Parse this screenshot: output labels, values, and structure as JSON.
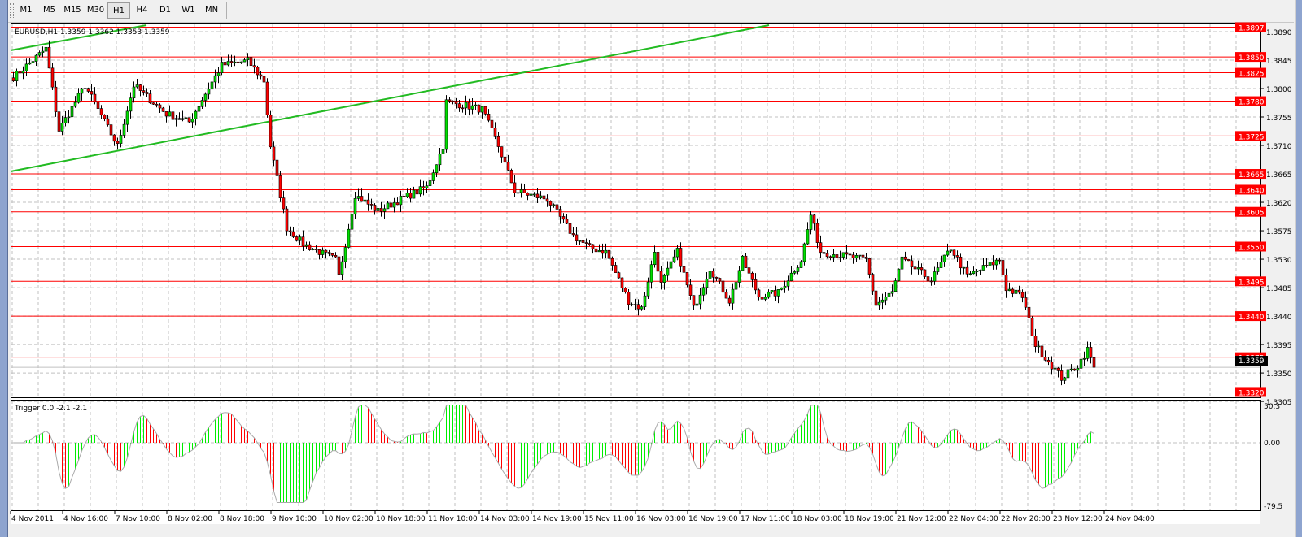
{
  "toolbar": {
    "timeframes": [
      "M1",
      "M5",
      "M15",
      "M30",
      "H1",
      "H4",
      "D1",
      "W1",
      "MN"
    ],
    "active": "H1"
  },
  "chart": {
    "title": "EURUSD,H1  1.3359 1.3362 1.3353 1.3359",
    "current_price": "1.3359",
    "price_ticks": [
      "1.3890",
      "1.3845",
      "1.3800",
      "1.3755",
      "1.3710",
      "1.3665",
      "1.3620",
      "1.3575",
      "1.3530",
      "1.3485",
      "1.3440",
      "1.3395",
      "1.3350",
      "1.3305"
    ],
    "levels": [
      "1.3897",
      "1.3850",
      "1.3825",
      "1.3780",
      "1.3725",
      "1.3665",
      "1.3640",
      "1.3605",
      "1.3550",
      "1.3495",
      "1.3440",
      "1.3375",
      "1.3320"
    ],
    "time_labels": [
      "4 Nov 2011",
      "4 Nov 16:00",
      "7 Nov 10:00",
      "8 Nov 02:00",
      "8 Nov 18:00",
      "9 Nov 10:00",
      "10 Nov 02:00",
      "10 Nov 18:00",
      "11 Nov 10:00",
      "14 Nov 03:00",
      "14 Nov 19:00",
      "15 Nov 11:00",
      "16 Nov 03:00",
      "16 Nov 19:00",
      "17 Nov 11:00",
      "18 Nov 03:00",
      "18 Nov 19:00",
      "21 Nov 12:00",
      "22 Nov 04:00",
      "22 Nov 20:00",
      "23 Nov 12:00",
      "24 Nov 04:00"
    ],
    "colors": {
      "level": "#ff0000",
      "bull": "#00e000",
      "bear": "#ff0000",
      "trend": "#22bb22"
    }
  },
  "indicator": {
    "title": "Trigger 0.0 -2.1 -2.1",
    "max_label": "50.3",
    "zero_label": "0.00",
    "min_label": "-79.5"
  },
  "chart_data": {
    "type": "candlestick",
    "symbol": "EURUSD",
    "timeframe": "H1",
    "ylim": [
      1.33,
      1.39
    ],
    "price_path": [
      [
        0,
        1.3818
      ],
      [
        10,
        1.3863
      ],
      [
        14,
        1.3734
      ],
      [
        22,
        1.3805
      ],
      [
        32,
        1.3709
      ],
      [
        37,
        1.3805
      ],
      [
        47,
        1.376
      ],
      [
        54,
        1.3747
      ],
      [
        64,
        1.3837
      ],
      [
        72,
        1.3844
      ],
      [
        77,
        1.3812
      ],
      [
        79,
        1.3709
      ],
      [
        84,
        1.358
      ],
      [
        89,
        1.3554
      ],
      [
        99,
        1.3529
      ],
      [
        100,
        1.3503
      ],
      [
        105,
        1.3632
      ],
      [
        112,
        1.3606
      ],
      [
        119,
        1.3625
      ],
      [
        127,
        1.3644
      ],
      [
        132,
        1.3709
      ],
      [
        133,
        1.3779
      ],
      [
        139,
        1.3773
      ],
      [
        144,
        1.3767
      ],
      [
        149,
        1.3709
      ],
      [
        154,
        1.3638
      ],
      [
        164,
        1.3625
      ],
      [
        172,
        1.3567
      ],
      [
        177,
        1.3548
      ],
      [
        182,
        1.3542
      ],
      [
        189,
        1.3464
      ],
      [
        193,
        1.3452
      ],
      [
        197,
        1.3542
      ],
      [
        199,
        1.349
      ],
      [
        204,
        1.3542
      ],
      [
        209,
        1.3452
      ],
      [
        214,
        1.3516
      ],
      [
        220,
        1.3464
      ],
      [
        224,
        1.3529
      ],
      [
        229,
        1.3471
      ],
      [
        235,
        1.3477
      ],
      [
        242,
        1.3529
      ],
      [
        245,
        1.36
      ],
      [
        248,
        1.3542
      ],
      [
        262,
        1.3529
      ],
      [
        265,
        1.3458
      ],
      [
        270,
        1.3477
      ],
      [
        273,
        1.3529
      ],
      [
        282,
        1.3497
      ],
      [
        288,
        1.3548
      ],
      [
        293,
        1.3503
      ],
      [
        303,
        1.3529
      ],
      [
        305,
        1.3484
      ],
      [
        310,
        1.3471
      ],
      [
        314,
        1.3394
      ],
      [
        319,
        1.3362
      ],
      [
        322,
        1.3342
      ],
      [
        327,
        1.3362
      ],
      [
        330,
        1.3387
      ],
      [
        332,
        1.3359
      ]
    ]
  }
}
